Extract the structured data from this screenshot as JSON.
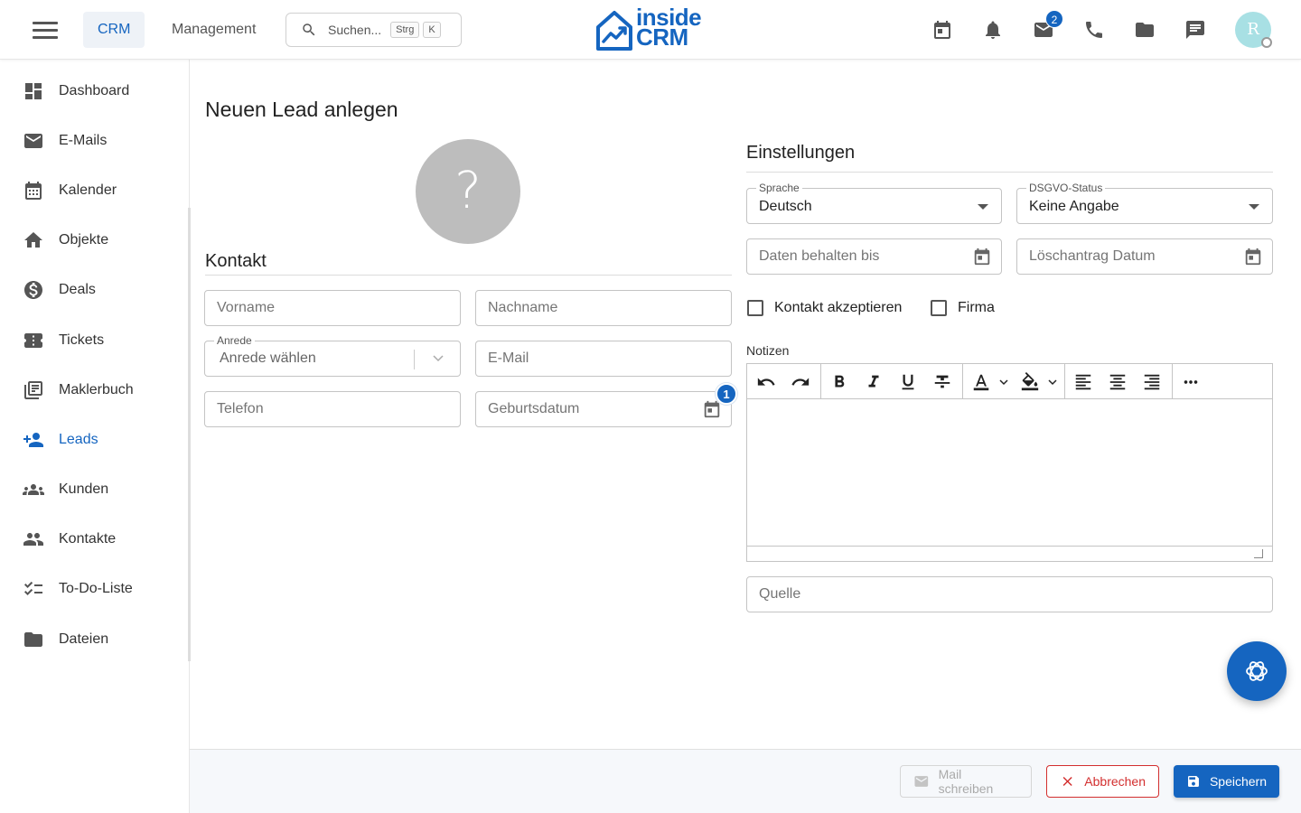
{
  "header": {
    "tabs": [
      {
        "label": "CRM"
      },
      {
        "label": "Management"
      }
    ],
    "search": {
      "placeholder": "Suchen...",
      "kbd1": "Strg",
      "kbd2": "K"
    },
    "logo": {
      "line1": "inside",
      "line2": "CRM"
    },
    "mail_badge": "2",
    "avatar_initial": "R",
    "icons": [
      "calendar-icon",
      "bell-icon",
      "mail-icon",
      "phone-icon",
      "folder-icon",
      "chat-icon"
    ]
  },
  "sidebar": {
    "items": [
      {
        "label": "Dashboard",
        "icon": "dashboard-icon"
      },
      {
        "label": "E-Mails",
        "icon": "mail-icon"
      },
      {
        "label": "Kalender",
        "icon": "calendar-icon"
      },
      {
        "label": "Objekte",
        "icon": "house-icon"
      },
      {
        "label": "Deals",
        "icon": "dollar-icon"
      },
      {
        "label": "Tickets",
        "icon": "ticket-icon"
      },
      {
        "label": "Maklerbuch",
        "icon": "library-icon"
      },
      {
        "label": "Leads",
        "icon": "person-add-icon",
        "active": true
      },
      {
        "label": "Kunden",
        "icon": "groups-icon"
      },
      {
        "label": "Kontakte",
        "icon": "people-icon"
      },
      {
        "label": "To-Do-Liste",
        "icon": "checklist-icon"
      },
      {
        "label": "Dateien",
        "icon": "folder-icon"
      }
    ],
    "active_color": "#1565c0"
  },
  "page": {
    "title": "Neuen Lead anlegen",
    "avatar_placeholder": "?"
  },
  "kontakt": {
    "title": "Kontakt",
    "vorname_placeholder": "Vorname",
    "nachname_placeholder": "Nachname",
    "anrede_label": "Anrede",
    "anrede_placeholder": "Anrede wählen",
    "email_placeholder": "E-Mail",
    "telefon_placeholder": "Telefon",
    "geburtsdatum_placeholder": "Geburtsdatum",
    "geburtsdatum_badge": "1"
  },
  "einstellungen": {
    "title": "Einstellungen",
    "sprache_label": "Sprache",
    "sprache_value": "Deutsch",
    "dsgvo_label": "DSGVO-Status",
    "dsgvo_value": "Keine Angabe",
    "daten_behalten_placeholder": "Daten behalten bis",
    "loeschantrag_placeholder": "Löschantrag Datum",
    "checkbox_kontakt": "Kontakt akzeptieren",
    "checkbox_firma": "Firma",
    "notizen_label": "Notizen",
    "quelle_placeholder": "Quelle"
  },
  "actions": {
    "mail": "Mail schreiben",
    "cancel": "Abbrechen",
    "save": "Speichern"
  },
  "colors": {
    "primary": "#1565c0",
    "danger": "#d32f2f"
  }
}
